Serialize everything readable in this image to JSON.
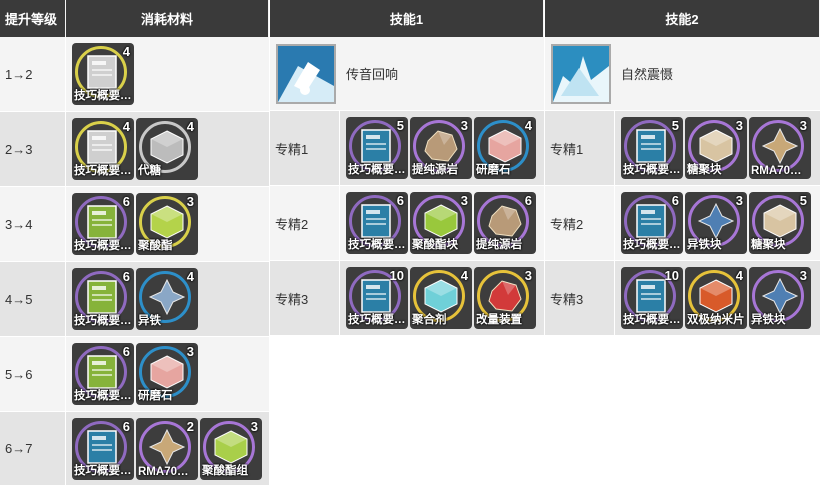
{
  "headers": {
    "level": "提升等级",
    "materials": "消耗材料",
    "skill1": "技能1",
    "skill2": "技能2"
  },
  "level_rows": [
    {
      "level": "1→2",
      "items": [
        {
          "name": "技巧概要…",
          "count": "4",
          "kind": "book-1"
        }
      ]
    },
    {
      "level": "2→3",
      "items": [
        {
          "name": "技巧概要…",
          "count": "4",
          "kind": "book-1"
        },
        {
          "name": "代糖",
          "count": "4",
          "kind": "sugar-sub"
        }
      ]
    },
    {
      "level": "3→4",
      "items": [
        {
          "name": "技巧概要…",
          "count": "6",
          "kind": "book-2"
        },
        {
          "name": "聚酸酯",
          "count": "3",
          "kind": "polyester"
        }
      ]
    },
    {
      "level": "4→5",
      "items": [
        {
          "name": "技巧概要…",
          "count": "6",
          "kind": "book-2"
        },
        {
          "name": "异铁",
          "count": "4",
          "kind": "oriron"
        }
      ]
    },
    {
      "level": "5→6",
      "items": [
        {
          "name": "技巧概要…",
          "count": "6",
          "kind": "book-2"
        },
        {
          "name": "研磨石",
          "count": "3",
          "kind": "grindstone"
        }
      ]
    },
    {
      "level": "6→7",
      "items": [
        {
          "name": "技巧概要…",
          "count": "6",
          "kind": "book-3"
        },
        {
          "name": "RMA70…",
          "count": "2",
          "kind": "rma"
        },
        {
          "name": "聚酸酯组",
          "count": "3",
          "kind": "polyester-pack"
        }
      ]
    }
  ],
  "skill1": {
    "name": "传音回响",
    "icon": "bell-skill-icon",
    "rows": [
      {
        "label": "专精1",
        "items": [
          {
            "name": "技巧概要…",
            "count": "5",
            "kind": "book-3"
          },
          {
            "name": "提纯源岩",
            "count": "3",
            "kind": "orirock-cube"
          },
          {
            "name": "研磨石",
            "count": "4",
            "kind": "grindstone"
          }
        ]
      },
      {
        "label": "专精2",
        "items": [
          {
            "name": "技巧概要…",
            "count": "6",
            "kind": "book-3"
          },
          {
            "name": "聚酸酯块",
            "count": "3",
            "kind": "polyester-lump"
          },
          {
            "name": "提纯源岩",
            "count": "6",
            "kind": "orirock-cube"
          }
        ]
      },
      {
        "label": "专精3",
        "items": [
          {
            "name": "技巧概要…",
            "count": "10",
            "kind": "book-3"
          },
          {
            "name": "聚合剂",
            "count": "4",
            "kind": "polymerizer"
          },
          {
            "name": "改量装置",
            "count": "3",
            "kind": "device"
          }
        ]
      }
    ]
  },
  "skill2": {
    "name": "自然震慑",
    "icon": "shatter-skill-icon",
    "rows": [
      {
        "label": "专精1",
        "items": [
          {
            "name": "技巧概要…",
            "count": "5",
            "kind": "book-3"
          },
          {
            "name": "糖聚块",
            "count": "3",
            "kind": "sugar-lump"
          },
          {
            "name": "RMA70…",
            "count": "3",
            "kind": "rma"
          }
        ]
      },
      {
        "label": "专精2",
        "items": [
          {
            "name": "技巧概要…",
            "count": "6",
            "kind": "book-3"
          },
          {
            "name": "异铁块",
            "count": "3",
            "kind": "oriron-block"
          },
          {
            "name": "糖聚块",
            "count": "5",
            "kind": "sugar-lump"
          }
        ]
      },
      {
        "label": "专精3",
        "items": [
          {
            "name": "技巧概要…",
            "count": "10",
            "kind": "book-3"
          },
          {
            "name": "双极纳米片",
            "count": "4",
            "kind": "nanoflake"
          },
          {
            "name": "异铁块",
            "count": "3",
            "kind": "oriron-block"
          }
        ]
      }
    ]
  },
  "colors": {
    "header_bg": "#3a3a3a",
    "row_light": "#f4f4f4",
    "row_dark": "#e4e4e4",
    "tile_bg": "#3d3d3d"
  }
}
